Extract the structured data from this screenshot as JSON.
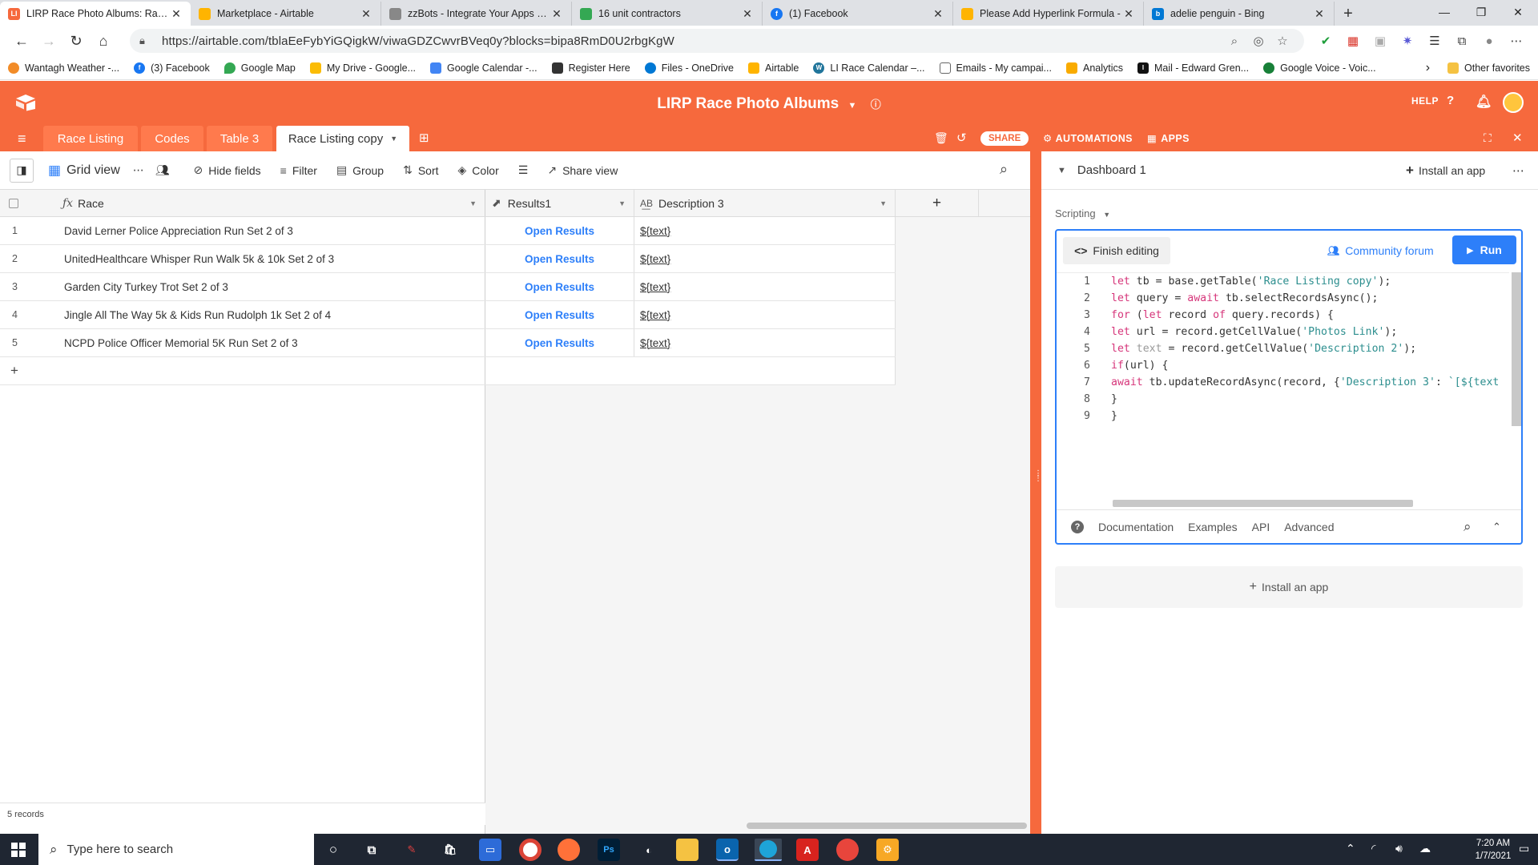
{
  "browser": {
    "tabs": [
      {
        "title": "LIRP Race Photo Albums: Race L",
        "favicon": "LI",
        "color": "#f6693d",
        "active": true
      },
      {
        "title": "Marketplace - Airtable",
        "favicon": "",
        "color": "#ffb400",
        "active": false
      },
      {
        "title": "zzBots - Integrate Your Apps & A",
        "favicon": "",
        "color": "#888888",
        "active": false
      },
      {
        "title": "16 unit contractors",
        "favicon": "",
        "color": "#34a853",
        "active": false
      },
      {
        "title": "(1) Facebook",
        "favicon": "f",
        "color": "#1877f2",
        "active": false
      },
      {
        "title": "Please Add Hyperlink Formula -",
        "favicon": "",
        "color": "#ffb400",
        "active": false
      },
      {
        "title": "adelie penguin - Bing",
        "favicon": "b",
        "color": "#0078d4",
        "active": false
      }
    ],
    "url": "https://airtable.com/tblaEeFybYiGQigkW/viwaGDZCwvrBVeq0y?blocks=bipa8RmD0U2rbgKgW",
    "bookmarks": [
      {
        "label": "Wantagh Weather -...",
        "color": "#f28c28"
      },
      {
        "label": "(3) Facebook",
        "color": "#1877f2"
      },
      {
        "label": "Google Map",
        "color": "#34a853"
      },
      {
        "label": "My Drive - Google...",
        "color": "#fbbc05"
      },
      {
        "label": "Google Calendar -...",
        "color": "#4285f4"
      },
      {
        "label": "Register Here",
        "color": "#333333"
      },
      {
        "label": "Files - OneDrive",
        "color": "#0078d4"
      },
      {
        "label": "Airtable",
        "color": "#ffb400"
      },
      {
        "label": "LI Race Calendar –...",
        "color": "#21759b"
      },
      {
        "label": "Emails - My campai...",
        "color": "#666666"
      },
      {
        "label": "Analytics",
        "color": "#f9ab00"
      },
      {
        "label": "Mail - Edward Gren...",
        "color": "#111111"
      },
      {
        "label": "Google Voice - Voic...",
        "color": "#188038"
      }
    ],
    "other_favorites": "Other favorites"
  },
  "airtable": {
    "base_name": "LIRP Race Photo Albums",
    "help": "HELP",
    "table_tabs": [
      "Race Listing",
      "Codes",
      "Table 3",
      "Race Listing copy"
    ],
    "share": "SHARE",
    "automations": "AUTOMATIONS",
    "apps": "APPS",
    "toolbar": {
      "view": "Grid view",
      "hide_fields": "Hide fields",
      "filter": "Filter",
      "group": "Group",
      "sort": "Sort",
      "color": "Color",
      "share_view": "Share view"
    },
    "columns": [
      "Race",
      "Results1",
      "Description 3"
    ],
    "rows": [
      {
        "num": "1",
        "race": "David Lerner Police Appreciation Run Set 2 of 3",
        "results": "Open Results",
        "desc": "${text}"
      },
      {
        "num": "2",
        "race": "UnitedHealthcare Whisper Run Walk 5k & 10k Set 2 of 3",
        "results": "Open Results",
        "desc": "${text}"
      },
      {
        "num": "3",
        "race": "Garden City Turkey Trot Set 2 of 3",
        "results": "Open Results",
        "desc": "${text}"
      },
      {
        "num": "4",
        "race": "Jingle All The Way 5k & Kids Run Rudolph 1k Set 2 of 4",
        "results": "Open Results",
        "desc": "${text}"
      },
      {
        "num": "5",
        "race": "NCPD Police Officer Memorial 5K Run Set 2 of 3",
        "results": "Open Results",
        "desc": "${text}"
      }
    ],
    "record_count": "5 records"
  },
  "dashboard": {
    "title": "Dashboard 1",
    "install_app": "Install an app",
    "scripting_label": "Scripting",
    "finish_editing": "Finish editing",
    "community_forum": "Community forum",
    "run": "Run",
    "footer_links": [
      "Documentation",
      "Examples",
      "API",
      "Advanced"
    ],
    "install_box": "Install an app"
  },
  "taskbar": {
    "search_placeholder": "Type here to search",
    "time": "7:20 AM",
    "date": "1/7/2021"
  },
  "colors": {
    "airtable_orange": "#f6693d",
    "link_blue": "#2d7ff9"
  }
}
